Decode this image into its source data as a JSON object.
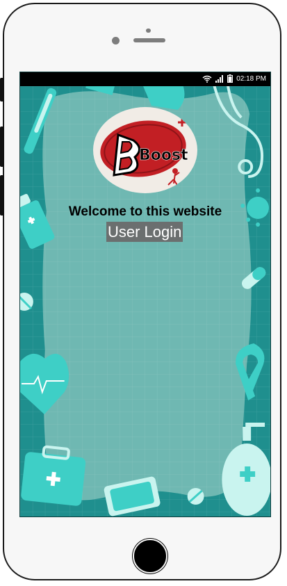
{
  "status_bar": {
    "time": "02:18 PM",
    "icons": [
      "wifi-icon",
      "signal-icon",
      "battery-icon"
    ]
  },
  "logo": {
    "text": "Boost"
  },
  "main": {
    "welcome_text": "Welcome to this website",
    "login_label": "User Login"
  },
  "colors": {
    "background_teal": "#1f8f8e",
    "panel_teal": "#6fb8b2",
    "accent_cyan": "#3ecfc6",
    "logo_red": "#c21f24",
    "login_button_bg": "#6b6f6f"
  }
}
